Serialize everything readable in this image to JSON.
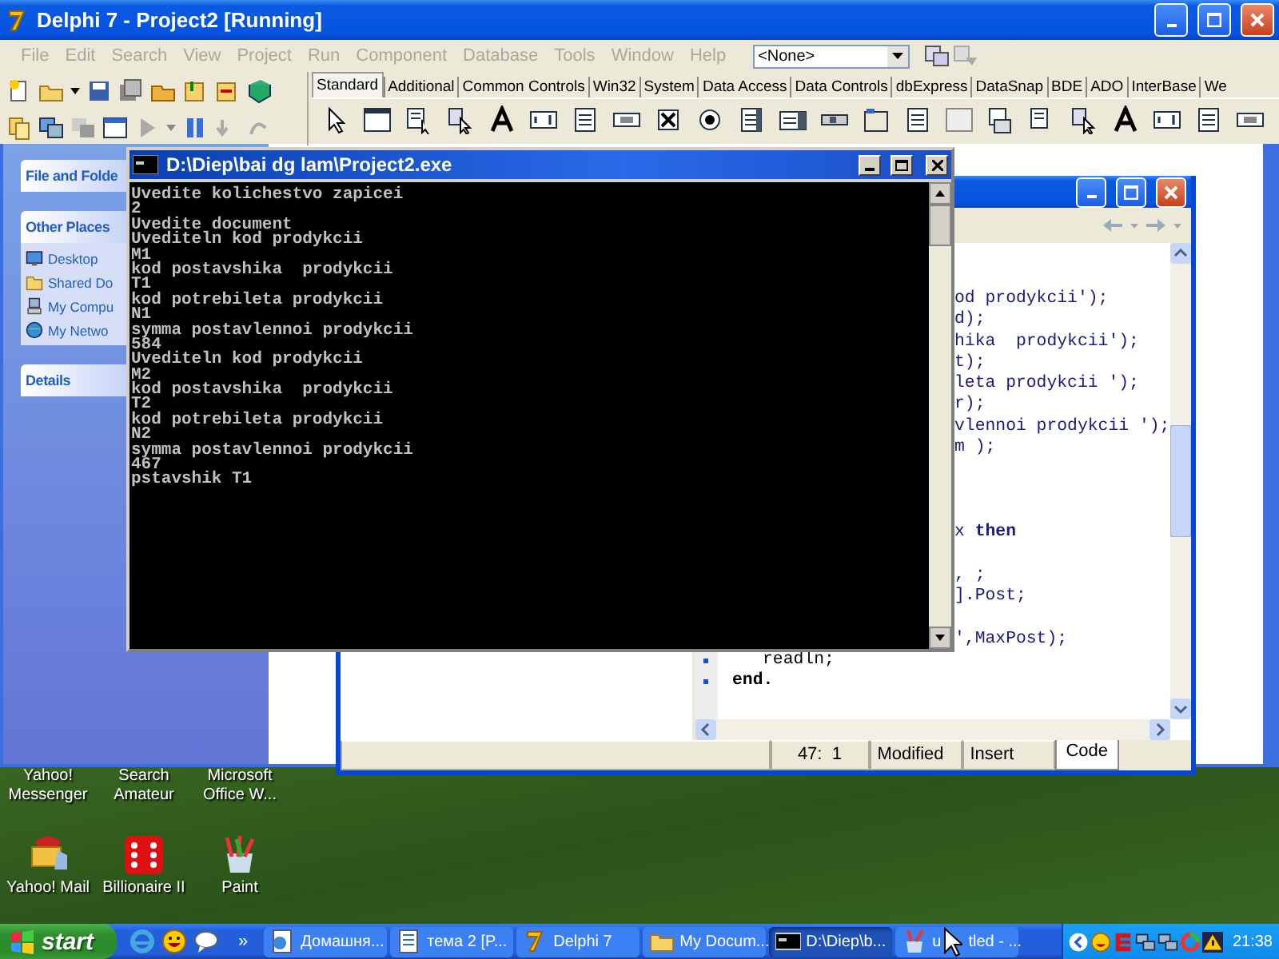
{
  "delphi": {
    "title": "Delphi 7 - Project2 [Running]",
    "menu": [
      {
        "label": "File",
        "disabled": true
      },
      {
        "label": "Edit",
        "disabled": true
      },
      {
        "label": "Search",
        "disabled": true
      },
      {
        "label": "View",
        "disabled": true
      },
      {
        "label": "Project",
        "disabled": true
      },
      {
        "label": "Run",
        "disabled": true
      },
      {
        "label": "Component",
        "disabled": true
      },
      {
        "label": "Database",
        "disabled": true
      },
      {
        "label": "Tools",
        "disabled": true
      },
      {
        "label": "Window",
        "disabled": true
      },
      {
        "label": "Help",
        "disabled": true
      }
    ],
    "combo": {
      "value": "<None>"
    },
    "palette_tabs": [
      {
        "label": "Standard",
        "selected": true
      },
      {
        "label": "Additional",
        "selected": false
      },
      {
        "label": "Common Controls",
        "selected": false
      },
      {
        "label": "Win32",
        "selected": false
      },
      {
        "label": "System",
        "selected": false
      },
      {
        "label": "Data Access",
        "selected": false
      },
      {
        "label": "Data Controls",
        "selected": false
      },
      {
        "label": "dbExpress",
        "selected": false
      },
      {
        "label": "DataSnap",
        "selected": false
      },
      {
        "label": "BDE",
        "selected": false
      },
      {
        "label": "ADO",
        "selected": false
      },
      {
        "label": "InterBase",
        "selected": false
      },
      {
        "label": "We",
        "selected": false
      }
    ]
  },
  "explorer": {
    "sections": [
      {
        "title": "File and Folde"
      },
      {
        "title": "Other Places",
        "items": [
          "Desktop",
          "Shared Do",
          "My Compu",
          "My Netwo"
        ]
      },
      {
        "title": "Details"
      }
    ]
  },
  "editor": {
    "lines": [
      {
        "kind": "fragment",
        "text": "od prodykcii');"
      },
      {
        "kind": "fragment",
        "text": "d);"
      },
      {
        "kind": "fragment",
        "text": "hika  prodykcii');"
      },
      {
        "kind": "fragment",
        "text": "t);"
      },
      {
        "kind": "fragment",
        "text": "leta prodykcii ');"
      },
      {
        "kind": "fragment",
        "text": "r);"
      },
      {
        "kind": "fragment",
        "text": "vlennoi prodykcii ');"
      },
      {
        "kind": "fragment",
        "text": "m );"
      },
      {
        "kind": "blank"
      },
      {
        "kind": "blank"
      },
      {
        "kind": "blank"
      },
      {
        "kind": "fragment",
        "text": "x **then**"
      },
      {
        "kind": "blank"
      },
      {
        "kind": "fragment",
        "text": ", ;"
      },
      {
        "kind": "fragment",
        "text": "].Post;"
      },
      {
        "kind": "blank"
      },
      {
        "kind": "fragment",
        "text": "',MaxPost);"
      },
      {
        "kind": "indented",
        "text": "readln;"
      },
      {
        "kind": "keyword",
        "text": "end."
      }
    ],
    "status": {
      "position": "47:  1",
      "modified": "Modified",
      "mode": "Insert"
    },
    "tabs": [
      {
        "label": "Code",
        "selected": true
      }
    ]
  },
  "console": {
    "title": "D:\\Diep\\bai dg lam\\Project2.exe",
    "lines": [
      "Uvedite kolichestvo zapicei",
      "2",
      "Uvedite document",
      "Uvediteln kod prodykcii",
      "M1",
      "kod postavshika  prodykcii",
      "T1",
      "kod potrebileta prodykcii",
      "N1",
      "symma postavlennoi prodykcii",
      "584",
      "Uvediteln kod prodykcii",
      "M2",
      "kod postavshika  prodykcii",
      "T2",
      "kod potrebileta prodykcii",
      "N2",
      "symma postavlennoi prodykcii",
      "467",
      "pstavshik T1"
    ]
  },
  "desktop_icons": [
    {
      "label": "Yahoo! Messenger",
      "kind": "label_only"
    },
    {
      "label": "Search Amateur",
      "kind": "label_only"
    },
    {
      "label": "Microsoft Office W...",
      "kind": "label_only"
    },
    {
      "label": "Yahoo! Mail",
      "kind": "icon"
    },
    {
      "label": "Billionaire II",
      "kind": "icon"
    },
    {
      "label": "Paint",
      "kind": "icon"
    }
  ],
  "taskbar": {
    "start": "start",
    "more": "»",
    "tasks": [
      {
        "label": "Домашня...",
        "selected": false
      },
      {
        "label": "тема 2 [P...",
        "selected": false
      },
      {
        "label": "Delphi 7",
        "selected": false
      },
      {
        "label": "My Docum...",
        "selected": false
      },
      {
        "label": "D:\\Diep\\b...",
        "selected": true
      },
      {
        "label": "u",
        "tail": "tled - ...",
        "selected": false
      }
    ],
    "clock": "21:38"
  }
}
